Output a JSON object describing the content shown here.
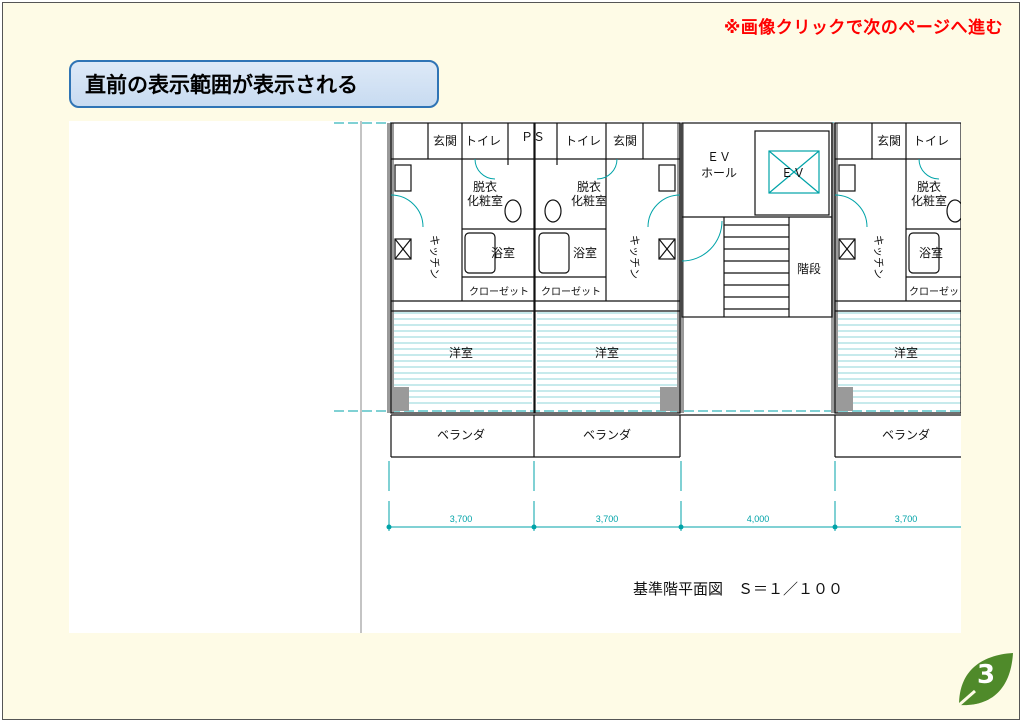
{
  "nav_hint": "※画像クリックで次のページへ進む",
  "callout_text": "直前の表示範囲が表示される",
  "page_number": "3",
  "plan": {
    "labels": {
      "entrance": "玄関",
      "toilet": "トイレ",
      "ps": "ＰＳ",
      "ev_hall_line1": "ＥＶ",
      "ev_hall_line2": "ホール",
      "ev": "ＥＶ",
      "stairs": "階段",
      "dressing_line1": "脱衣",
      "dressing_line2": "化粧室",
      "kitchen": "キッチン",
      "bathroom": "浴室",
      "closet": "クローゼット",
      "western_room": "洋室",
      "veranda": "ベランダ"
    },
    "dimensions": [
      "3,700",
      "3,700",
      "4,000",
      "3,700"
    ],
    "caption": "基準階平面図　Ｓ＝１／１００"
  },
  "colors": {
    "accent": "#2f74b5",
    "nav_hint": "#ff0000",
    "plan_line": "#00a3a8",
    "badge": "#4f8a2a"
  },
  "icons": {
    "page_badge": "leaf-icon"
  }
}
